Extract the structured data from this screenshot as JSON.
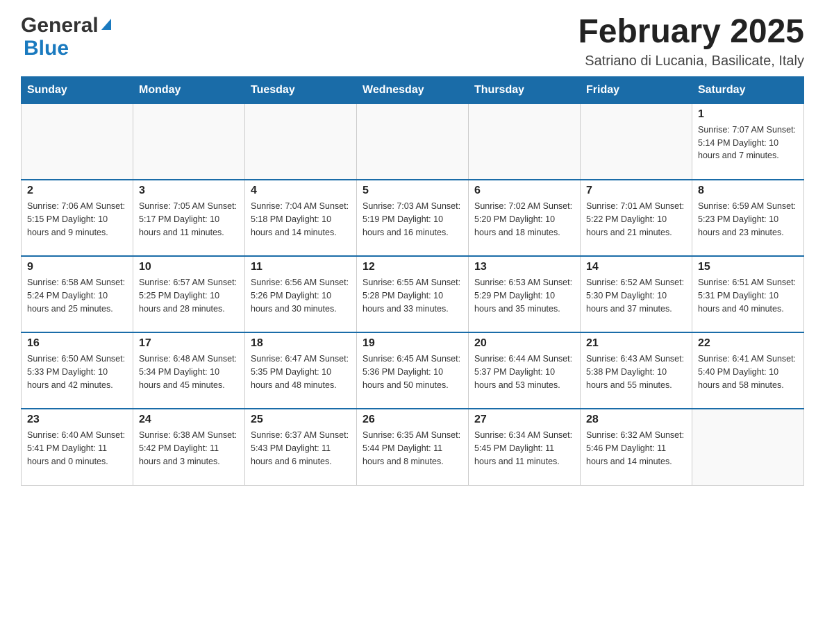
{
  "header": {
    "logo_general": "General",
    "logo_blue": "Blue",
    "month_title": "February 2025",
    "location": "Satriano di Lucania, Basilicate, Italy"
  },
  "weekdays": [
    "Sunday",
    "Monday",
    "Tuesday",
    "Wednesday",
    "Thursday",
    "Friday",
    "Saturday"
  ],
  "weeks": [
    [
      {
        "day": "",
        "info": ""
      },
      {
        "day": "",
        "info": ""
      },
      {
        "day": "",
        "info": ""
      },
      {
        "day": "",
        "info": ""
      },
      {
        "day": "",
        "info": ""
      },
      {
        "day": "",
        "info": ""
      },
      {
        "day": "1",
        "info": "Sunrise: 7:07 AM\nSunset: 5:14 PM\nDaylight: 10 hours\nand 7 minutes."
      }
    ],
    [
      {
        "day": "2",
        "info": "Sunrise: 7:06 AM\nSunset: 5:15 PM\nDaylight: 10 hours\nand 9 minutes."
      },
      {
        "day": "3",
        "info": "Sunrise: 7:05 AM\nSunset: 5:17 PM\nDaylight: 10 hours\nand 11 minutes."
      },
      {
        "day": "4",
        "info": "Sunrise: 7:04 AM\nSunset: 5:18 PM\nDaylight: 10 hours\nand 14 minutes."
      },
      {
        "day": "5",
        "info": "Sunrise: 7:03 AM\nSunset: 5:19 PM\nDaylight: 10 hours\nand 16 minutes."
      },
      {
        "day": "6",
        "info": "Sunrise: 7:02 AM\nSunset: 5:20 PM\nDaylight: 10 hours\nand 18 minutes."
      },
      {
        "day": "7",
        "info": "Sunrise: 7:01 AM\nSunset: 5:22 PM\nDaylight: 10 hours\nand 21 minutes."
      },
      {
        "day": "8",
        "info": "Sunrise: 6:59 AM\nSunset: 5:23 PM\nDaylight: 10 hours\nand 23 minutes."
      }
    ],
    [
      {
        "day": "9",
        "info": "Sunrise: 6:58 AM\nSunset: 5:24 PM\nDaylight: 10 hours\nand 25 minutes."
      },
      {
        "day": "10",
        "info": "Sunrise: 6:57 AM\nSunset: 5:25 PM\nDaylight: 10 hours\nand 28 minutes."
      },
      {
        "day": "11",
        "info": "Sunrise: 6:56 AM\nSunset: 5:26 PM\nDaylight: 10 hours\nand 30 minutes."
      },
      {
        "day": "12",
        "info": "Sunrise: 6:55 AM\nSunset: 5:28 PM\nDaylight: 10 hours\nand 33 minutes."
      },
      {
        "day": "13",
        "info": "Sunrise: 6:53 AM\nSunset: 5:29 PM\nDaylight: 10 hours\nand 35 minutes."
      },
      {
        "day": "14",
        "info": "Sunrise: 6:52 AM\nSunset: 5:30 PM\nDaylight: 10 hours\nand 37 minutes."
      },
      {
        "day": "15",
        "info": "Sunrise: 6:51 AM\nSunset: 5:31 PM\nDaylight: 10 hours\nand 40 minutes."
      }
    ],
    [
      {
        "day": "16",
        "info": "Sunrise: 6:50 AM\nSunset: 5:33 PM\nDaylight: 10 hours\nand 42 minutes."
      },
      {
        "day": "17",
        "info": "Sunrise: 6:48 AM\nSunset: 5:34 PM\nDaylight: 10 hours\nand 45 minutes."
      },
      {
        "day": "18",
        "info": "Sunrise: 6:47 AM\nSunset: 5:35 PM\nDaylight: 10 hours\nand 48 minutes."
      },
      {
        "day": "19",
        "info": "Sunrise: 6:45 AM\nSunset: 5:36 PM\nDaylight: 10 hours\nand 50 minutes."
      },
      {
        "day": "20",
        "info": "Sunrise: 6:44 AM\nSunset: 5:37 PM\nDaylight: 10 hours\nand 53 minutes."
      },
      {
        "day": "21",
        "info": "Sunrise: 6:43 AM\nSunset: 5:38 PM\nDaylight: 10 hours\nand 55 minutes."
      },
      {
        "day": "22",
        "info": "Sunrise: 6:41 AM\nSunset: 5:40 PM\nDaylight: 10 hours\nand 58 minutes."
      }
    ],
    [
      {
        "day": "23",
        "info": "Sunrise: 6:40 AM\nSunset: 5:41 PM\nDaylight: 11 hours\nand 0 minutes."
      },
      {
        "day": "24",
        "info": "Sunrise: 6:38 AM\nSunset: 5:42 PM\nDaylight: 11 hours\nand 3 minutes."
      },
      {
        "day": "25",
        "info": "Sunrise: 6:37 AM\nSunset: 5:43 PM\nDaylight: 11 hours\nand 6 minutes."
      },
      {
        "day": "26",
        "info": "Sunrise: 6:35 AM\nSunset: 5:44 PM\nDaylight: 11 hours\nand 8 minutes."
      },
      {
        "day": "27",
        "info": "Sunrise: 6:34 AM\nSunset: 5:45 PM\nDaylight: 11 hours\nand 11 minutes."
      },
      {
        "day": "28",
        "info": "Sunrise: 6:32 AM\nSunset: 5:46 PM\nDaylight: 11 hours\nand 14 minutes."
      },
      {
        "day": "",
        "info": ""
      }
    ]
  ]
}
